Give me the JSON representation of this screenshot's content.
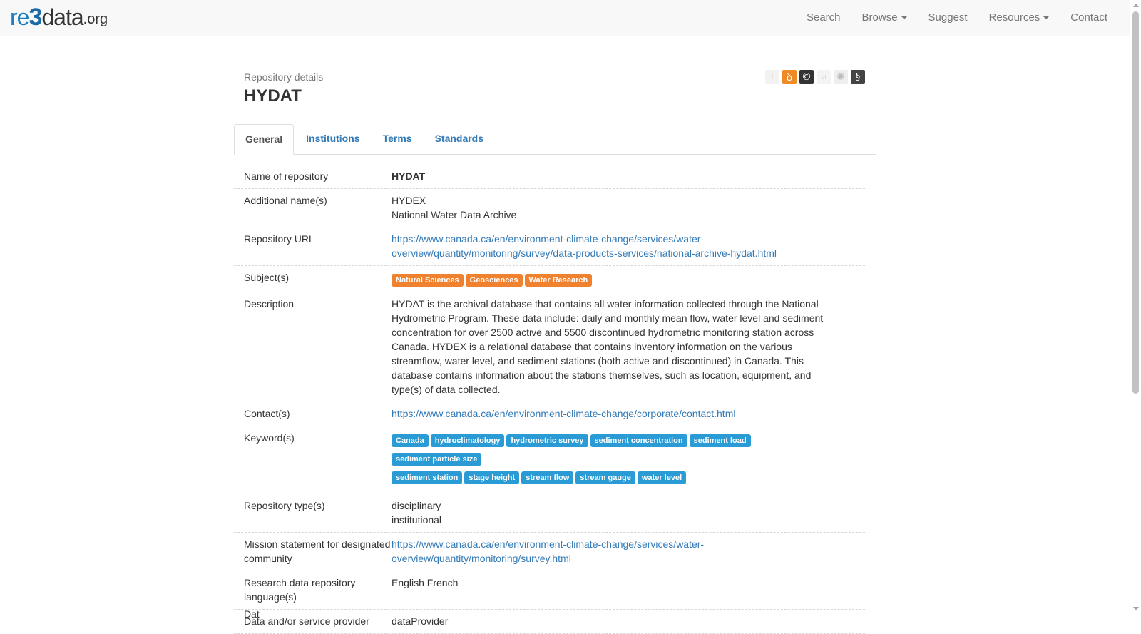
{
  "navbar": {
    "logo": {
      "re": "re",
      "three": "3",
      "data": "data",
      "org": ".org"
    },
    "links": [
      {
        "label": "Search",
        "has_caret": false
      },
      {
        "label": "Browse",
        "has_caret": true
      },
      {
        "label": "Suggest",
        "has_caret": false
      },
      {
        "label": "Resources",
        "has_caret": true
      },
      {
        "label": "Contact",
        "has_caret": false
      }
    ]
  },
  "header": {
    "subtitle": "Repository details",
    "title": "HYDAT"
  },
  "badges": [
    {
      "icon": "info-icon",
      "glyph": "i"
    },
    {
      "icon": "open-access-icon",
      "glyph": "ꝺ"
    },
    {
      "icon": "copyright-icon",
      "glyph": "©"
    },
    {
      "icon": "pid-icon",
      "glyph": "pi"
    },
    {
      "icon": "certificate-icon",
      "glyph": "✺"
    },
    {
      "icon": "policy-icon",
      "glyph": "§"
    }
  ],
  "tabs": [
    {
      "label": "General",
      "active": true
    },
    {
      "label": "Institutions",
      "active": false
    },
    {
      "label": "Terms",
      "active": false
    },
    {
      "label": "Standards",
      "active": false
    }
  ],
  "details": {
    "name": {
      "label": "Name of repository",
      "value": "HYDAT"
    },
    "additional_names": {
      "label": "Additional name(s)",
      "values": [
        "HYDEX",
        "National Water Data Archive"
      ]
    },
    "url": {
      "label": "Repository URL",
      "lines": [
        "https://www.canada.ca/en/environment-climate-change/services/water-",
        "overview/quantity/monitoring/survey/data-products-services/national-archive-hydat.html"
      ]
    },
    "subjects": {
      "label": "Subject(s)",
      "values": [
        "Natural Sciences",
        "Geosciences",
        "Water Research"
      ]
    },
    "description": {
      "label": "Description",
      "lines": [
        "HYDAT is the archival database that contains all water information collected through the National",
        "Hydrometric Program. These data include: daily and monthly mean flow, water level and sediment",
        "concentration for over 2500 active and 5500 discontinued hydrometric monitoring station across",
        "Canada. HYDEX is a relational database that contains inventory information on the various",
        "streamflow, water level, and sediment stations (both active and discontinued) in Canada. This",
        "database contains information about the stations themselves, such as location, equipment, and",
        "type(s) of data collected."
      ]
    },
    "contacts": {
      "label": "Contact(s)",
      "value": "https://www.canada.ca/en/environment-climate-change/corporate/contact.html"
    },
    "keywords": {
      "label": "Keyword(s)",
      "values": [
        "Canada",
        "hydroclimatology",
        "hydrometric survey",
        "sediment concentration",
        "sediment load",
        "sediment particle size",
        "sediment station",
        "stage height",
        "stream flow",
        "stream gauge",
        "water level"
      ]
    },
    "repo_types": {
      "label": "Repository type(s)",
      "values": [
        "disciplinary",
        "institutional"
      ]
    },
    "mission": {
      "label_lines": [
        "Mission statement for",
        "designated community"
      ],
      "lines": [
        "https://www.canada.ca/en/environment-climate-change/services/water-",
        "overview/quantity/monitoring/survey.html"
      ]
    },
    "languages": {
      "label_lines": [
        "Research data repository",
        "language(s)"
      ],
      "value": "English French"
    },
    "provider": {
      "label": "Data and/or service provider",
      "value": "dataProvider"
    }
  },
  "partial_next": "Dat"
}
